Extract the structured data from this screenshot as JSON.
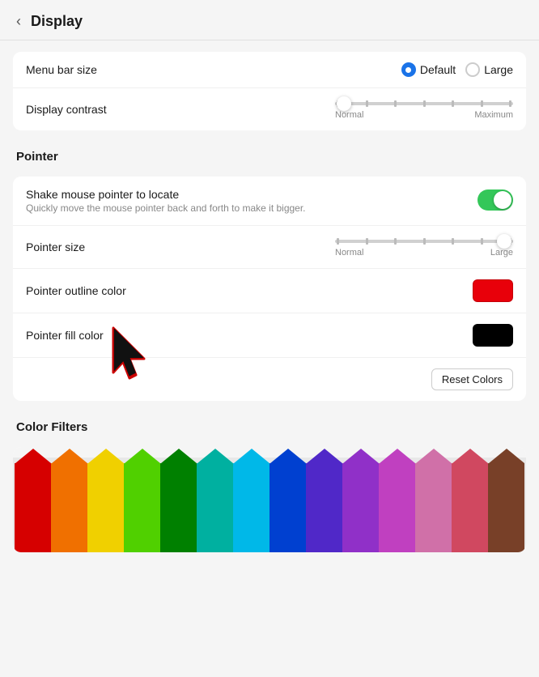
{
  "header": {
    "back_label": "‹",
    "title": "Display"
  },
  "sections": {
    "display": {
      "menu_bar_size_label": "Menu bar size",
      "radio_default_label": "Default",
      "radio_large_label": "Large",
      "display_contrast_label": "Display contrast",
      "contrast_normal_label": "Normal",
      "contrast_maximum_label": "Maximum"
    },
    "pointer": {
      "heading": "Pointer",
      "shake_label": "Shake mouse pointer to locate",
      "shake_desc": "Quickly move the mouse pointer back and forth to make it bigger.",
      "pointer_size_label": "Pointer size",
      "pointer_size_normal": "Normal",
      "pointer_size_large": "Large",
      "outline_color_label": "Pointer outline color",
      "fill_color_label": "Pointer fill color",
      "reset_btn_label": "Reset Colors",
      "outline_color": "#e8000a",
      "fill_color": "#000000"
    },
    "color_filters": {
      "heading": "Color Filters"
    }
  },
  "pencils": [
    {
      "body": "#d60000",
      "tip_border": "#a00000"
    },
    {
      "body": "#f07000",
      "tip_border": "#c05000"
    },
    {
      "body": "#f0d000",
      "tip_border": "#c0a800"
    },
    {
      "body": "#50d000",
      "tip_border": "#38a000"
    },
    {
      "body": "#008000",
      "tip_border": "#005800"
    },
    {
      "body": "#00b0a0",
      "tip_border": "#007870"
    },
    {
      "body": "#00b8e8",
      "tip_border": "#0090c0"
    },
    {
      "body": "#0040d0",
      "tip_border": "#0030a0"
    },
    {
      "body": "#5028c8",
      "tip_border": "#3810a0"
    },
    {
      "body": "#9030c8",
      "tip_border": "#7018a0"
    },
    {
      "body": "#c040c0",
      "tip_border": "#a02898"
    },
    {
      "body": "#d070a8",
      "tip_border": "#b04880"
    },
    {
      "body": "#d04860",
      "tip_border": "#a03040"
    },
    {
      "body": "#784028",
      "tip_border": "#502810"
    }
  ]
}
